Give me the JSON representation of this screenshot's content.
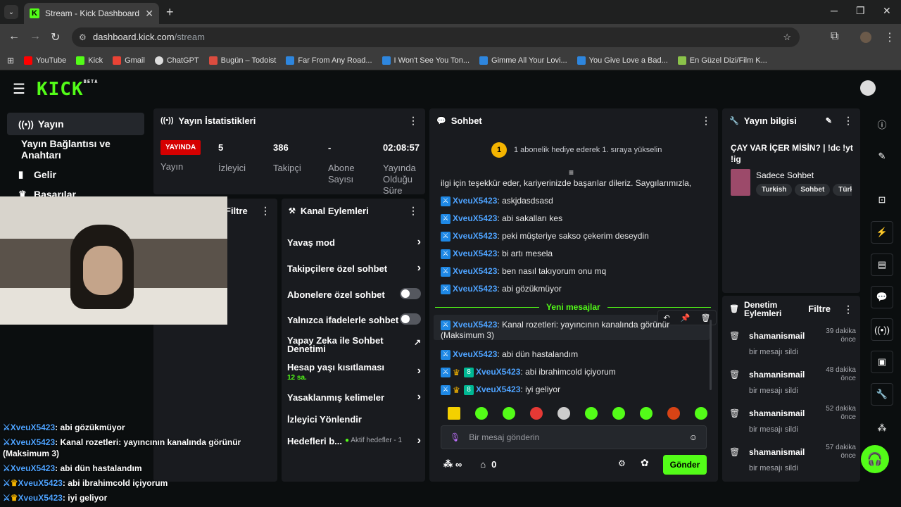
{
  "browser": {
    "tab_title": "Stream - Kick Dashboard",
    "url_host": "dashboard.kick.com",
    "url_path": "/stream",
    "bookmarks": [
      "YouTube",
      "Kick",
      "Gmail",
      "ChatGPT",
      "Bugün – Todoist",
      "Far From Any Road...",
      "I Won't See You Ton...",
      "Gimme All Your Lovi...",
      "You Give Love a Bad...",
      "En Güzel Dizi/Film K..."
    ]
  },
  "logo": "KICK",
  "logo_beta": "BETA",
  "sidebar": {
    "items": [
      {
        "label": "Yayın"
      },
      {
        "label": "Yayın Bağlantısı ve Anahtarı"
      },
      {
        "label": "Gelir"
      },
      {
        "label": "Başarılar"
      }
    ]
  },
  "stats": {
    "title": "Yayın İstatistikleri",
    "live": "YAYINDA",
    "live_label": "Yayın",
    "items": [
      {
        "value": "5",
        "label": "İzleyici"
      },
      {
        "value": "386",
        "label": "Takipçi"
      },
      {
        "value": "-",
        "label": "Abone Sayısı"
      },
      {
        "value": "02:08:57",
        "label": "Yayında Olduğu Süre"
      }
    ]
  },
  "filter_partial": "Filtre",
  "actions": {
    "title": "Kanal Eylemleri",
    "items": [
      {
        "label": "Yavaş mod",
        "type": "arrow"
      },
      {
        "label": "Takipçilere özel sohbet",
        "type": "arrow"
      },
      {
        "label": "Abonelere özel sohbet",
        "type": "toggle"
      },
      {
        "label": "Yalnızca ifadelerle sohbet",
        "type": "toggle"
      },
      {
        "label": "Yapay Zeka ile Sohbet Denetimi",
        "type": "ext"
      },
      {
        "label": "Hesap yaşı kısıtlaması",
        "sub": "12 sa.",
        "type": "arrow"
      },
      {
        "label": "Yasaklanmış kelimeler",
        "type": "arrow"
      },
      {
        "label": "İzleyici Yönlendir",
        "type": "none"
      },
      {
        "label": "Hedefleri b...",
        "sub": "Aktif hedefler - 1",
        "type": "arrow"
      }
    ]
  },
  "chat": {
    "title": "Sohbet",
    "gift_banner": "1 abonelik hediye ederek 1. sıraya yükselin",
    "gift_rank": "1",
    "intro": "ilgi için teşekkür eder, kariyerinizde başarılar dileriz. Saygılarımızla,",
    "messages": [
      {
        "user": "XveuX5423",
        "text": "askjdasdsasd"
      },
      {
        "user": "XveuX5423",
        "text": "abi sakalları kes"
      },
      {
        "user": "XveuX5423",
        "text": "peki müşteriye sakso çekerim deseydin"
      },
      {
        "user": "XveuX5423",
        "text": "bi artı mesela"
      },
      {
        "user": "XveuX5423",
        "text": "ben nasıl takıyorum onu mq"
      },
      {
        "user": "XveuX5423",
        "text": "abi gözükmüyor"
      }
    ],
    "new_label": "Yeni mesajlar",
    "new_messages": [
      {
        "user": "XveuX5423",
        "text": "Kanal rozetleri: yayıncının kanalında görünür (Maksimum 3)"
      },
      {
        "user": "XveuX5423",
        "text": "abi dün hastalandım"
      },
      {
        "user": "XveuX5423",
        "text": "abi ibrahimcold içiyorum"
      },
      {
        "user": "XveuX5423",
        "text": "iyi geliyor"
      }
    ],
    "input_placeholder": "Bir mesaj gönderin",
    "points": "∞",
    "chest_count": "0",
    "send": "Gönder"
  },
  "info": {
    "title": "Yayın bilgisi",
    "stream_title": "ÇAY VAR İÇER MİSİN? | !dc !yt !ig",
    "category": "Sadece Sohbet",
    "tags": [
      "Turkish",
      "Sohbet",
      "Türk"
    ]
  },
  "moderation": {
    "title": "Denetim Eylemleri",
    "filter": "Filtre",
    "items": [
      {
        "user": "shamanismail",
        "action": "bir mesajı sildi",
        "time": "39 dakika önce"
      },
      {
        "user": "shamanismail",
        "action": "bir mesajı sildi",
        "time": "48 dakika önce"
      },
      {
        "user": "shamanismail",
        "action": "bir mesajı sildi",
        "time": "52 dakika önce"
      },
      {
        "user": "shamanismail",
        "action": "bir mesajı sildi",
        "time": "57 dakika önce"
      }
    ]
  },
  "overlay": [
    {
      "user": "XveuX5423",
      "text": "abi gözükmüyor"
    },
    {
      "user": "XveuX5423",
      "text": "Kanal rozetleri: yayıncının kanalında görünür"
    },
    {
      "user": "",
      "text": "(Maksimum 3)"
    },
    {
      "user": "XveuX5423",
      "text": "abi dün hastalandım"
    },
    {
      "user": "XveuX5423",
      "text": "abi ibrahimcold içiyorum"
    },
    {
      "user": "XveuX5423",
      "text": "iyi geliyor"
    }
  ]
}
